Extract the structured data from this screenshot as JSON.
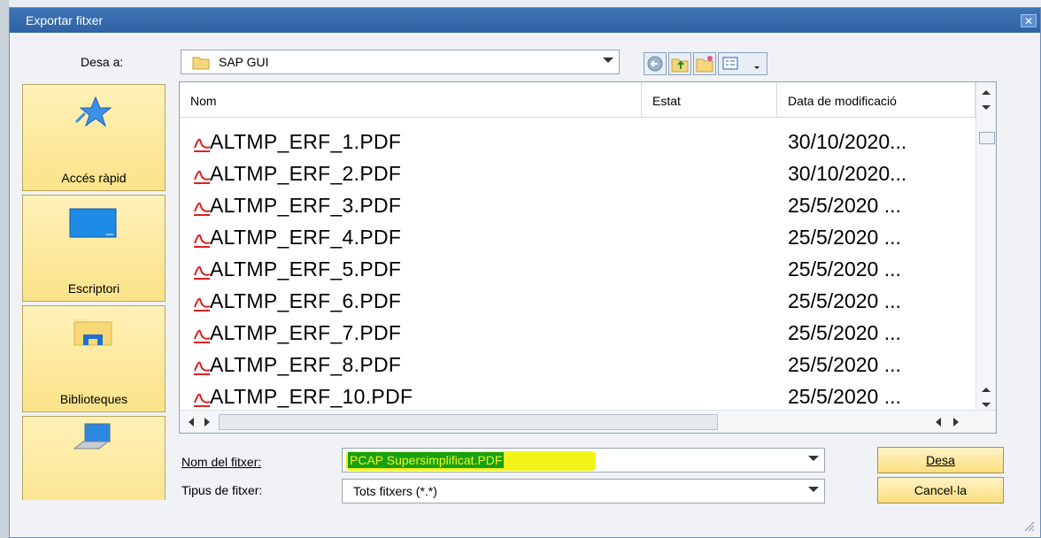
{
  "dialog": {
    "title": "Exportar fitxer",
    "close_glyph": "✕"
  },
  "save_in": {
    "label": "Desa a:",
    "value": "SAP GUI"
  },
  "places": [
    {
      "label": "Accés ràpid",
      "icon": "star-icon"
    },
    {
      "label": "Escriptori",
      "icon": "desktop-icon"
    },
    {
      "label": "Biblioteques",
      "icon": "libraries-icon"
    },
    {
      "label": "",
      "icon": "computer-icon"
    }
  ],
  "file_list": {
    "columns": {
      "name": "Nom",
      "status": "Estat",
      "modified": "Data de modificació"
    },
    "files": [
      {
        "name": "ALTMP_ERF_1.PDF",
        "date": "30/10/2020..."
      },
      {
        "name": "ALTMP_ERF_2.PDF",
        "date": "30/10/2020..."
      },
      {
        "name": "ALTMP_ERF_3.PDF",
        "date": "25/5/2020 ..."
      },
      {
        "name": "ALTMP_ERF_4.PDF",
        "date": "25/5/2020 ..."
      },
      {
        "name": "ALTMP_ERF_5.PDF",
        "date": "25/5/2020 ..."
      },
      {
        "name": "ALTMP_ERF_6.PDF",
        "date": "25/5/2020 ..."
      },
      {
        "name": "ALTMP_ERF_7.PDF",
        "date": "25/5/2020 ..."
      },
      {
        "name": "ALTMP_ERF_8.PDF",
        "date": "25/5/2020 ..."
      },
      {
        "name": "ALTMP_ERF_10.PDF",
        "date": "25/5/2020 ..."
      }
    ]
  },
  "filename": {
    "label": "Nom del fitxer:",
    "value": "PCAP Supersimplificat.PDF",
    "highlight": "#f3f31a"
  },
  "filetype": {
    "label": "Tipus de fitxer:",
    "value": "Tots fitxers (*.*)"
  },
  "buttons": {
    "save": "Desa",
    "cancel": "Cancel·la"
  }
}
